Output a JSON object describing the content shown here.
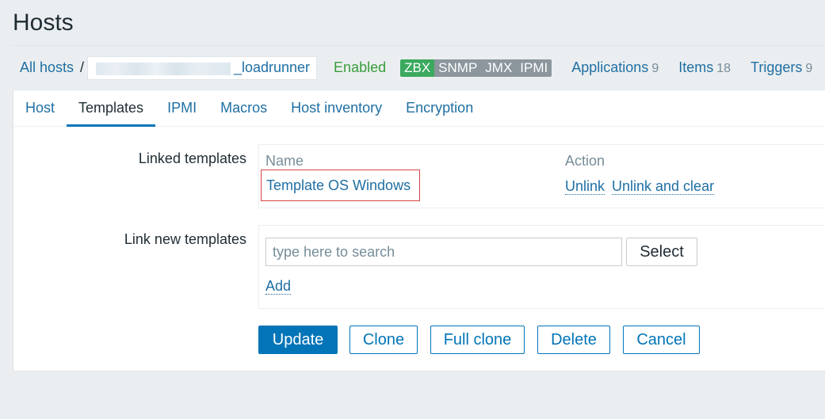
{
  "page": {
    "title": "Hosts"
  },
  "breadcrumb": {
    "all_hosts": "All hosts",
    "separator": "/",
    "host_name_suffix": "_loadrunner",
    "status": "Enabled",
    "badges": [
      "ZBX",
      "SNMP",
      "JMX",
      "IPMI"
    ],
    "nav": [
      {
        "label": "Applications",
        "count": "9"
      },
      {
        "label": "Items",
        "count": "18"
      },
      {
        "label": "Triggers",
        "count": "9"
      }
    ]
  },
  "tabs": [
    "Host",
    "Templates",
    "IPMI",
    "Macros",
    "Host inventory",
    "Encryption"
  ],
  "active_tab": "Templates",
  "linked_templates": {
    "label": "Linked templates",
    "col_name": "Name",
    "col_action": "Action",
    "rows": [
      {
        "name": "Template OS Windows",
        "unlink": "Unlink",
        "unlink_clear": "Unlink and clear"
      }
    ]
  },
  "link_new": {
    "label": "Link new templates",
    "placeholder": "type here to search",
    "select": "Select",
    "add": "Add"
  },
  "buttons": {
    "update": "Update",
    "clone": "Clone",
    "full_clone": "Full clone",
    "delete": "Delete",
    "cancel": "Cancel"
  },
  "colors": {
    "link": "#1f6fa3",
    "primary": "#0275b8",
    "enabled": "#3a9d3a",
    "zbx_badge": "#3ba95e",
    "gray_badge": "#8c969d",
    "highlight_border": "#d64545"
  }
}
